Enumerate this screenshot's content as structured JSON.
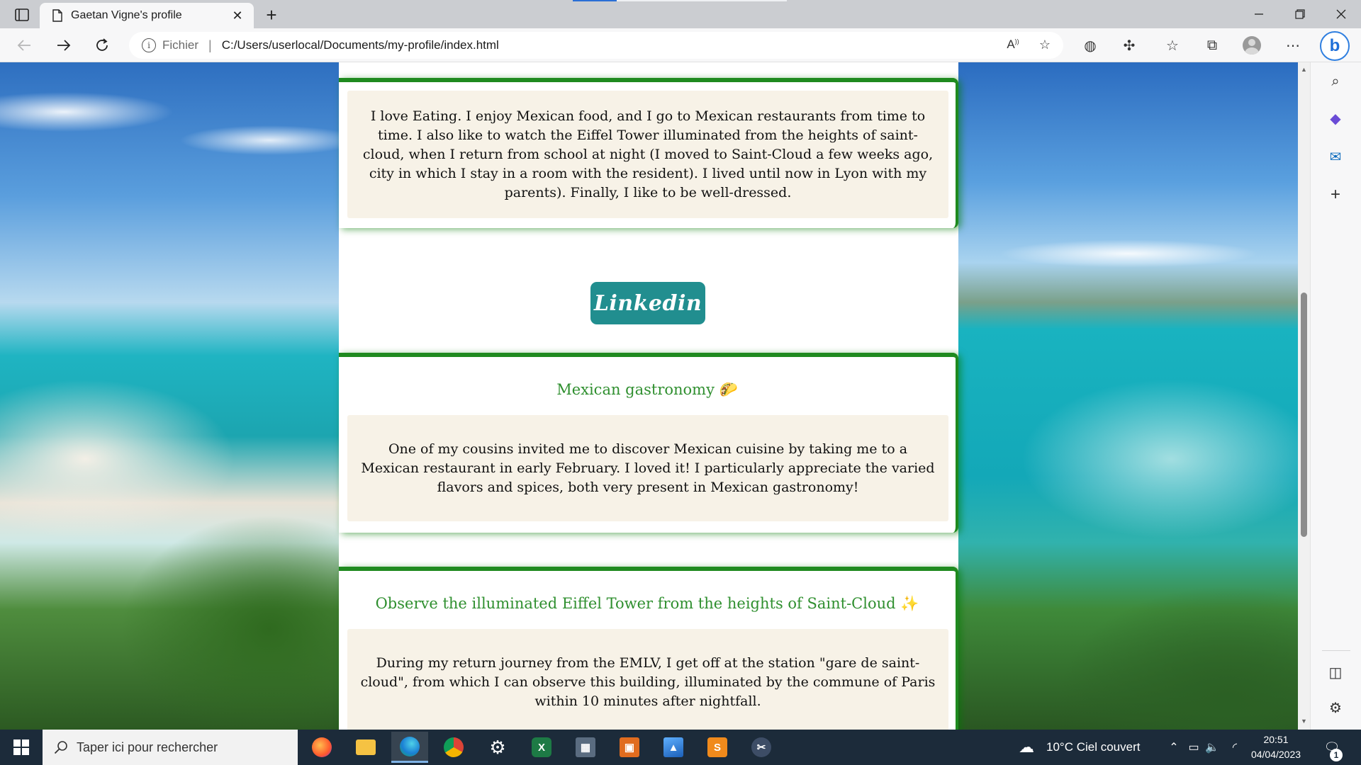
{
  "browser": {
    "tab": {
      "title": "Gaetan Vigne's profile"
    },
    "address": {
      "scheme": "Fichier",
      "separator": "|",
      "url": "C:/Users/userlocal/Documents/my-profile/index.html"
    }
  },
  "page": {
    "hobbies_text": "I love Eating. I enjoy Mexican food, and I go to Mexican restaurants from time to time. I also like to watch the Eiffel Tower illuminated from the heights of saint-cloud, when I return from school at night (I moved to Saint-Cloud a few weeks ago, city in which I stay in a room with the resident). I lived until now in Lyon with my parents). Finally, I like to be well-dressed.",
    "linkedin_label": "Linkedin",
    "sections": [
      {
        "title": "Mexican gastronomy",
        "emoji": "🌮",
        "body": "One of my cousins invited me to discover Mexican cuisine by taking me to a Mexican restaurant in early February. I loved it! I particularly appreciate the varied flavors and spices, both very present in Mexican gastronomy!"
      },
      {
        "title": "Observe the illuminated Eiffel Tower from the heights of Saint-Cloud",
        "emoji": "✨",
        "body": "During my return journey from the EMLV, I get off at the station \"gare de saint-cloud\", from which I can observe this building, illuminated by the commune of Paris within 10 minutes after nightfall."
      }
    ]
  },
  "taskbar": {
    "search_placeholder": "Taper ici pour rechercher",
    "weather": "10°C  Ciel couvert",
    "time": "20:51",
    "date": "04/04/2023",
    "notification_count": "1"
  },
  "colors": {
    "accent_green": "#1f8a1f",
    "title_green": "#2f8f2f",
    "linkedin_teal": "#218e8f",
    "card_body_bg": "#f7f2e7"
  }
}
